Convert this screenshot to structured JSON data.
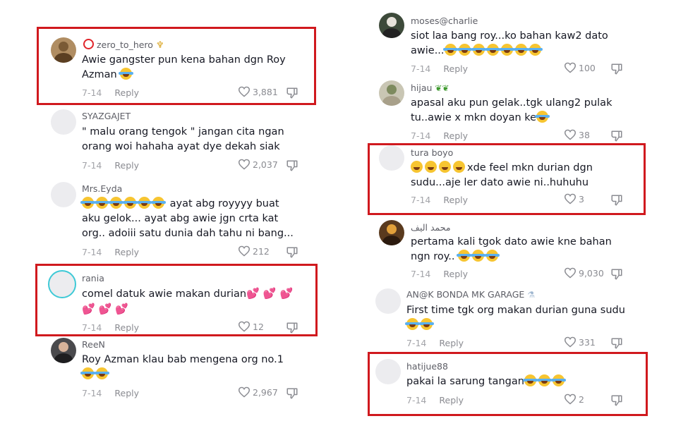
{
  "left_column": [
    {
      "username": "zero_to_hero",
      "text": "Awie gangster pun kena bahan dgn Roy Azman",
      "emojis": 1,
      "date": "7-14",
      "reply": "Reply",
      "likes": "3,881",
      "highlighted": true
    },
    {
      "username": "SYAZGAJET",
      "text": "\" malu orang tengok \" jangan cita ngan orang woi hahaha ayat dye dekah siak",
      "date": "7-14",
      "reply": "Reply",
      "likes": "2,037",
      "highlighted": false
    },
    {
      "username": "Mrs.Eyda",
      "text": "ayat abg royyyy buat aku gelok... ayat abg awie jgn crta kat org.. adoiii satu dunia dah tahu ni bang...",
      "emojis": 6,
      "date": "7-14",
      "reply": "Reply",
      "likes": "212",
      "highlighted": false
    },
    {
      "username": "rania",
      "text": "comel datuk awie makan durian",
      "date": "7-14",
      "reply": "Reply",
      "likes": "12",
      "highlighted": true
    },
    {
      "username": "ReeN",
      "text": "Roy Azman klau bab mengena org no.1",
      "date": "7-14",
      "reply": "Reply",
      "likes": "2,967",
      "highlighted": false
    }
  ],
  "right_column": [
    {
      "username": "moses@charlie",
      "text": "siot laa bang roy...ko bahan kaw2 dato awie...",
      "date": "7-14",
      "reply": "Reply",
      "likes": "100",
      "highlighted": false
    },
    {
      "username": "hijau",
      "text": "apasal aku pun gelak..tgk ulang2 pulak tu..awie x mkn doyan ke",
      "date": "7-14",
      "reply": "Reply",
      "likes": "38",
      "highlighted": false
    },
    {
      "username": "tura boyo",
      "text": "xde feel mkn durian dgn sudu...aje ler dato awie ni..huhuhu",
      "date": "7-14",
      "reply": "Reply",
      "likes": "3",
      "highlighted": true
    },
    {
      "username": "محمد اليف",
      "text": "pertama kali tgok dato awie kne bahan ngn roy..",
      "date": "7-14",
      "reply": "Reply",
      "likes": "9,030",
      "highlighted": false
    },
    {
      "username": "AN@K BONDA MK GARAGE",
      "text": "First time tgk org makan durian guna sudu",
      "date": "7-14",
      "reply": "Reply",
      "likes": "331",
      "highlighted": false
    },
    {
      "username": "hatijue88",
      "text": "pakai la sarung tangan",
      "date": "7-14",
      "reply": "Reply",
      "likes": "2",
      "highlighted": true
    }
  ],
  "icons": {
    "like": "heart-outline-icon",
    "dislike": "thumbs-down-outline-icon"
  },
  "colors": {
    "highlight_border": "#d0191e",
    "text": "#161823",
    "meta": "#a3a4a9"
  }
}
